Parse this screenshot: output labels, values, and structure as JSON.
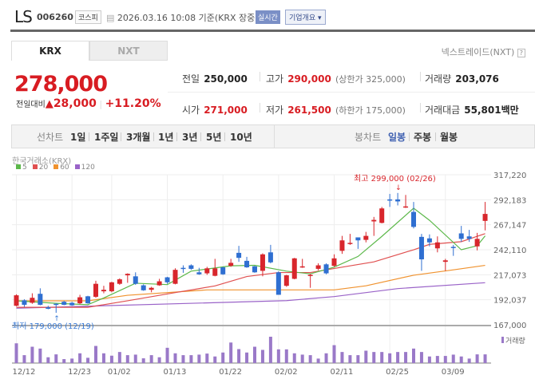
{
  "header": {
    "name": "LS",
    "code": "006260",
    "market_badge": "코스피",
    "datetime": "2026.03.16 10:08",
    "basis": "기준(KRX 장중)",
    "live_button": "실시간",
    "company_button": "기업개요"
  },
  "tabs": [
    {
      "label": "KRX",
      "active": true
    },
    {
      "label": "NXT",
      "active": false
    }
  ],
  "nxt_link": "넥스트레이드(NXT)",
  "quote": {
    "price": "278,000",
    "change_label": "전일대비",
    "change": "28,000",
    "change_pct": "+11.20%",
    "prev_label": "전일",
    "prev": "250,000",
    "high_label": "고가",
    "high": "290,000",
    "upper_limit": "(상한가 325,000)",
    "volume_label": "거래량",
    "volume": "203,076",
    "open_label": "시가",
    "open": "271,000",
    "low_label": "저가",
    "low": "261,500",
    "lower_limit": "(하한가 175,000)",
    "amount_label": "거래대금",
    "amount": "55,801",
    "amount_unit": "백만"
  },
  "toolbar": {
    "line_label": "선차트",
    "periods": [
      "1일",
      "1주일",
      "3개월",
      "1년",
      "3년",
      "5년",
      "10년"
    ],
    "candle_label": "봉차트",
    "candle_types": [
      "일봉",
      "주봉",
      "월봉"
    ],
    "active_candle": "일봉"
  },
  "colors": {
    "up": "#d8262c",
    "down": "#2f6fd1",
    "ma5": "#5cb84a",
    "ma20": "#e05050",
    "ma60": "#f0922e",
    "ma120": "#9a63c8",
    "volume": "#9a79c8"
  },
  "chart_data": {
    "type": "candlestick",
    "source_label": "한국거래소(KRX)",
    "legend": [
      {
        "name": "5",
        "color": "#5cb84a"
      },
      {
        "name": "20",
        "color": "#e05050"
      },
      {
        "name": "60",
        "color": "#f0922e"
      },
      {
        "name": "120",
        "color": "#9a63c8"
      }
    ],
    "y_ticks": [
      "317,220",
      "292,183",
      "267,147",
      "242,110",
      "217,073",
      "192,037",
      "167,000"
    ],
    "ylim": [
      167000,
      317220
    ],
    "x_labels": [
      {
        "i": 0,
        "label": "12/12"
      },
      {
        "i": 7,
        "label": "12/23"
      },
      {
        "i": 12,
        "label": "01/02"
      },
      {
        "i": 19,
        "label": "01/13"
      },
      {
        "i": 26,
        "label": "01/22"
      },
      {
        "i": 33,
        "label": "02/02"
      },
      {
        "i": 40,
        "label": "02/11"
      },
      {
        "i": 47,
        "label": "02/25"
      },
      {
        "i": 54,
        "label": "03/09"
      }
    ],
    "max_annotation": {
      "i": 48,
      "value": 299000,
      "label": "최고 299,000 (02/26)"
    },
    "min_annotation": {
      "i": 5,
      "value": 179000,
      "label": "최저 179,000 (12/19)"
    },
    "volume_label": "거래량",
    "ohlc": [
      [
        186000,
        197500,
        185500,
        196500
      ],
      [
        191500,
        192500,
        185000,
        187000
      ],
      [
        189000,
        198500,
        188000,
        194000
      ],
      [
        198000,
        203500,
        186500,
        187000
      ],
      [
        184500,
        186000,
        182500,
        183000
      ],
      [
        188000,
        188500,
        179000,
        187000
      ],
      [
        190000,
        191000,
        186500,
        187000
      ],
      [
        189000,
        190000,
        186000,
        186500
      ],
      [
        188500,
        197000,
        187500,
        194500
      ],
      [
        195500,
        196000,
        188000,
        188500
      ],
      [
        195000,
        211000,
        194000,
        208000
      ],
      [
        200500,
        206000,
        198500,
        202000
      ],
      [
        200500,
        210000,
        199500,
        209500
      ],
      [
        208000,
        213500,
        207000,
        212500
      ],
      [
        216500,
        218500,
        209000,
        218000
      ],
      [
        215500,
        219500,
        207000,
        208000
      ],
      [
        206500,
        207500,
        201000,
        201500
      ],
      [
        202000,
        205000,
        199500,
        204000
      ],
      [
        206500,
        213000,
        206000,
        210500
      ],
      [
        214500,
        215000,
        208000,
        209500
      ],
      [
        208000,
        223500,
        207500,
        222000
      ],
      [
        224000,
        226500,
        219000,
        223500
      ],
      [
        226500,
        227500,
        222000,
        223000
      ],
      [
        219500,
        224000,
        217000,
        217500
      ],
      [
        218500,
        225000,
        217000,
        223500
      ],
      [
        216000,
        233000,
        215500,
        223500
      ],
      [
        224500,
        225000,
        217000,
        217500
      ],
      [
        226000,
        233000,
        225000,
        229000
      ],
      [
        239000,
        246000,
        230000,
        234000
      ],
      [
        231000,
        235000,
        224000,
        224500
      ],
      [
        225500,
        226000,
        219000,
        219500
      ],
      [
        221000,
        238500,
        215500,
        237500
      ],
      [
        239500,
        247000,
        228500,
        229500
      ],
      [
        219500,
        220500,
        197000,
        197000
      ],
      [
        206000,
        217000,
        205000,
        216500
      ],
      [
        213000,
        234000,
        212500,
        233500
      ],
      [
        224500,
        233000,
        224000,
        225500
      ],
      [
        216000,
        218000,
        204000,
        217000
      ],
      [
        223000,
        228500,
        221500,
        226500
      ],
      [
        227500,
        228500,
        217500,
        218500
      ],
      [
        226000,
        237500,
        225000,
        233500
      ],
      [
        241000,
        256000,
        238000,
        251500
      ],
      [
        248000,
        258000,
        247000,
        249000
      ],
      [
        254500,
        254500,
        243000,
        251500
      ],
      [
        252000,
        260000,
        249500,
        256000
      ],
      [
        270500,
        275000,
        256000,
        272000
      ],
      [
        269000,
        285000,
        268500,
        283500
      ],
      [
        292500,
        298000,
        285000,
        292000
      ],
      [
        292500,
        299000,
        286500,
        290500
      ],
      [
        284500,
        297000,
        284000,
        285500
      ],
      [
        280000,
        290000,
        263500,
        265000
      ],
      [
        255000,
        258000,
        221000,
        232500
      ],
      [
        253500,
        257500,
        245500,
        249500
      ],
      [
        243500,
        255500,
        239500,
        249500
      ],
      [
        230000,
        233000,
        221000,
        231500
      ],
      [
        245000,
        247000,
        236000,
        244000
      ],
      [
        258500,
        266000,
        250000,
        253000
      ],
      [
        255500,
        262000,
        250000,
        253000
      ],
      [
        245500,
        259000,
        241500,
        253000
      ],
      [
        271000,
        290000,
        261500,
        278000
      ]
    ],
    "volume_relative": [
      75,
      30,
      62,
      55,
      22,
      33,
      15,
      17,
      37,
      20,
      65,
      37,
      28,
      42,
      30,
      32,
      18,
      30,
      22,
      58,
      37,
      30,
      30,
      32,
      36,
      25,
      40,
      78,
      53,
      40,
      62,
      50,
      100,
      52,
      52,
      37,
      32,
      30,
      17,
      37,
      68,
      42,
      30,
      30,
      47,
      42,
      42,
      37,
      42,
      42,
      55,
      42,
      25,
      27,
      27,
      32,
      25,
      17,
      33,
      33
    ],
    "ma5": [
      [
        0,
        191000
      ],
      [
        5,
        188500
      ],
      [
        9,
        187100
      ],
      [
        11,
        193800
      ],
      [
        15,
        208600
      ],
      [
        19,
        207200
      ],
      [
        22,
        220700
      ],
      [
        27,
        226000
      ],
      [
        30,
        226500
      ],
      [
        34,
        220700
      ],
      [
        37,
        218000
      ],
      [
        40,
        224700
      ],
      [
        43,
        235400
      ],
      [
        46,
        255500
      ],
      [
        50,
        283700
      ],
      [
        52,
        271600
      ],
      [
        56,
        242100
      ],
      [
        58,
        246100
      ],
      [
        59,
        256000
      ]
    ],
    "ma20": [
      [
        0,
        184500
      ],
      [
        9,
        184500
      ],
      [
        14,
        191000
      ],
      [
        20,
        199200
      ],
      [
        25,
        205900
      ],
      [
        29,
        215300
      ],
      [
        33,
        219300
      ],
      [
        37,
        219300
      ],
      [
        41,
        224700
      ],
      [
        45,
        230000
      ],
      [
        50,
        242100
      ],
      [
        52,
        247500
      ],
      [
        56,
        250200
      ],
      [
        59,
        258200
      ]
    ],
    "ma60": [
      [
        0,
        191000
      ],
      [
        9,
        191000
      ],
      [
        14,
        196500
      ],
      [
        24,
        201900
      ],
      [
        40,
        201900
      ],
      [
        44,
        206000
      ],
      [
        50,
        216600
      ],
      [
        55,
        222000
      ],
      [
        59,
        226500
      ]
    ],
    "ma120": [
      [
        0,
        183600
      ],
      [
        10,
        185800
      ],
      [
        34,
        191150
      ],
      [
        40,
        195200
      ],
      [
        48,
        203200
      ],
      [
        59,
        209100
      ]
    ]
  }
}
